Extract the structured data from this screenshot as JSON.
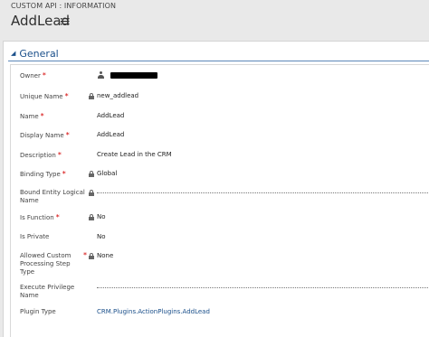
{
  "header": {
    "entity_label": "CUSTOM API : INFORMATION",
    "record_title": "AddLead",
    "icon": "list-icon"
  },
  "section": {
    "title": "General",
    "chevron_icon": "chevron-down-icon"
  },
  "fields": {
    "owner": {
      "label": "Owner",
      "required": "*",
      "value": ""
    },
    "unique_name": {
      "label": "Unique Name",
      "required": "*",
      "value": "new_addlead"
    },
    "name": {
      "label": "Name",
      "required": "*",
      "value": "AddLead"
    },
    "display_name": {
      "label": "Display Name",
      "required": "*",
      "value": "AddLead"
    },
    "description": {
      "label": "Description",
      "required": "*",
      "value": "Create Lead in the CRM"
    },
    "binding_type": {
      "label": "Binding Type",
      "required": "*",
      "value": "Global"
    },
    "bound_entity": {
      "label": "Bound Entity Logical Name",
      "value": ""
    },
    "is_function": {
      "label": "Is Function",
      "required": "*",
      "value": "No"
    },
    "is_private": {
      "label": "Is Private",
      "value": "No"
    },
    "allowed_step_type": {
      "label": "Allowed Custom Processing Step Type",
      "required": "*",
      "value": "None"
    },
    "execute_privilege": {
      "label": "Execute Privilege Name",
      "value": ""
    },
    "plugin_type": {
      "label": "Plugin Type",
      "value": "CRM.Plugins.ActionPlugins.AddLead"
    }
  }
}
